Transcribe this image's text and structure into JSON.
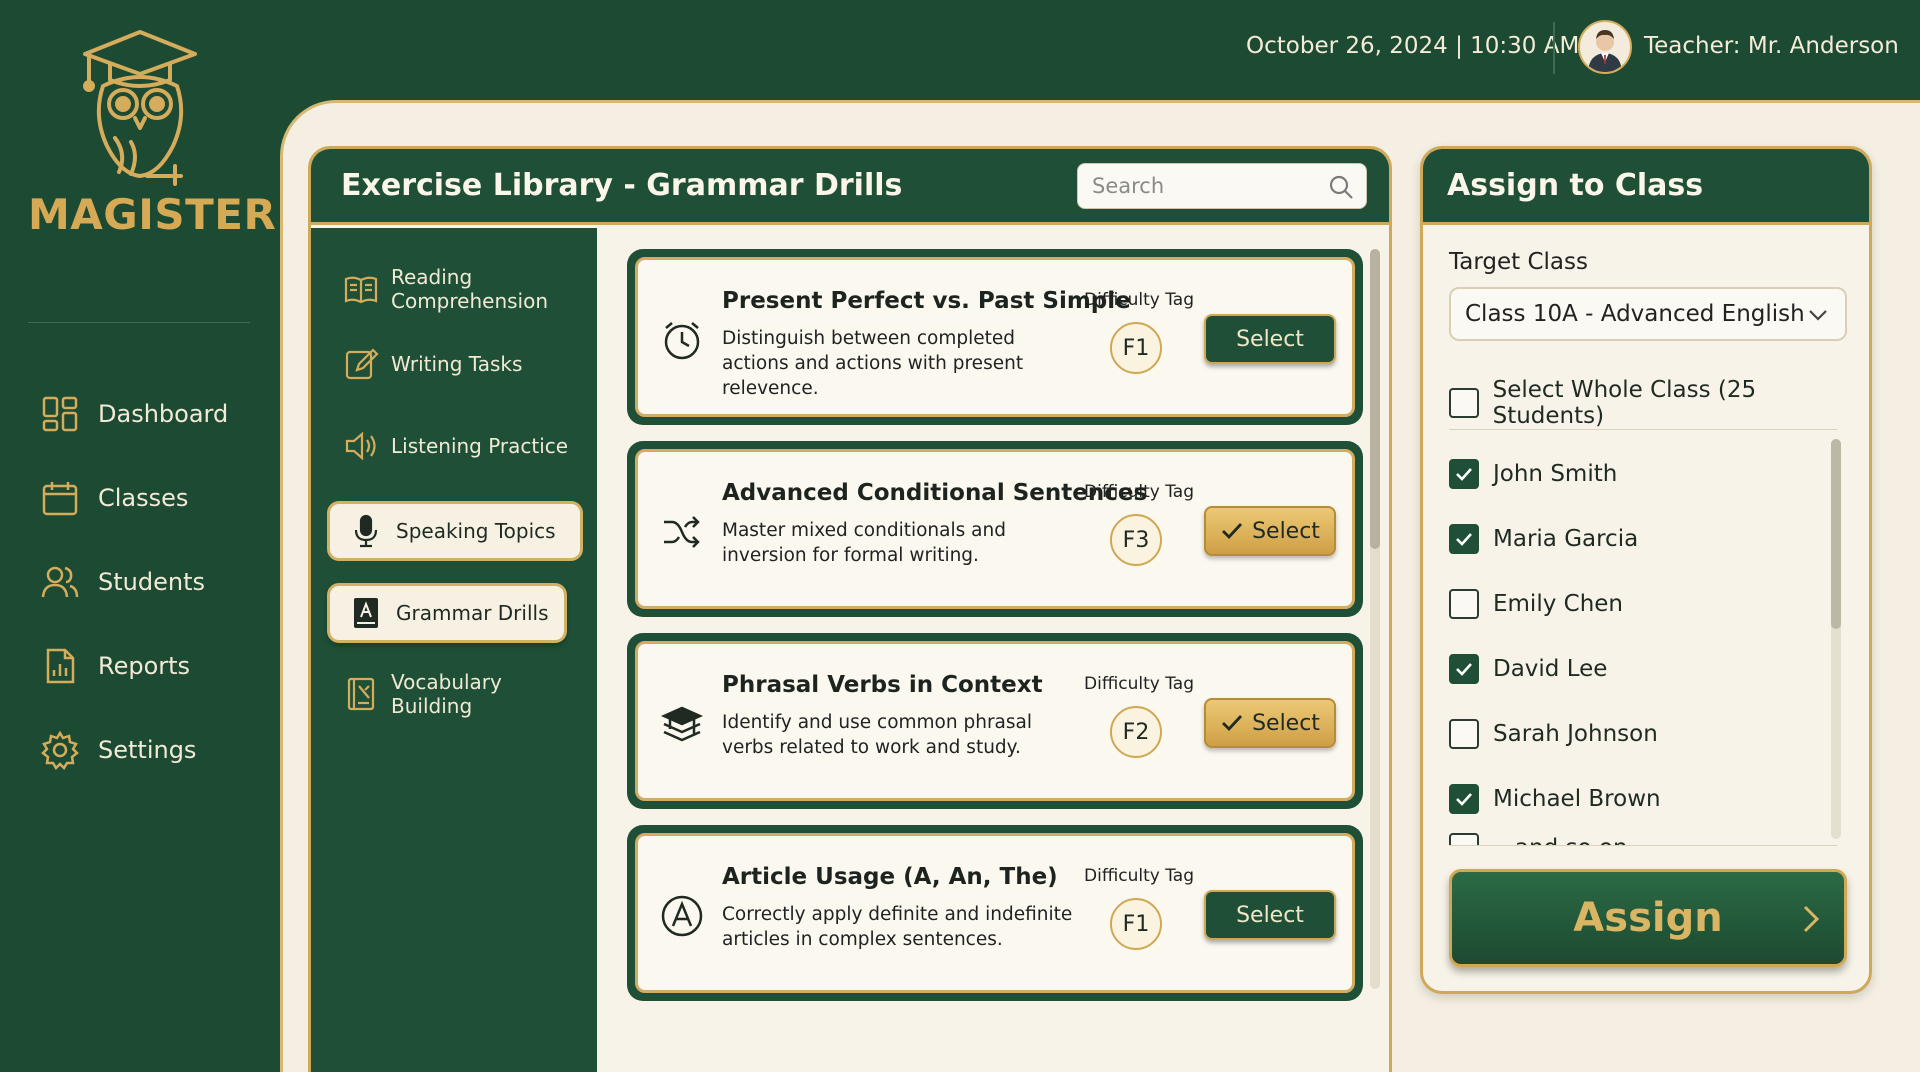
{
  "app": {
    "name": "MAGISTER"
  },
  "header": {
    "datetime": "October 26, 2024 | 10:30 AM",
    "teacher": "Teacher: Mr. Anderson"
  },
  "sidebar": {
    "items": [
      {
        "label": "Dashboard",
        "icon": "dashboard-icon"
      },
      {
        "label": "Classes",
        "icon": "calendar-icon"
      },
      {
        "label": "Students",
        "icon": "users-icon"
      },
      {
        "label": "Reports",
        "icon": "report-icon"
      },
      {
        "label": "Settings",
        "icon": "gear-icon"
      }
    ]
  },
  "library": {
    "title": "Exercise Library - Grammar Drills",
    "search_placeholder": "Search",
    "categories": [
      {
        "label": "Reading Comprehension",
        "icon": "book-icon"
      },
      {
        "label": "Writing Tasks",
        "icon": "pencil-icon"
      },
      {
        "label": "Listening Practice",
        "icon": "speaker-icon"
      },
      {
        "label": "Speaking Topics",
        "icon": "microphone-icon"
      },
      {
        "label": "Grammar Drills",
        "icon": "grammar-book-icon",
        "active": true
      },
      {
        "label": "Vocabulary Building",
        "icon": "vocabulary-icon"
      }
    ],
    "exercises": [
      {
        "title": "Present Perfect vs. Past Simple",
        "description": "Distinguish between completed actions and actions with present relevence.",
        "difficulty_label": "Difficulty Tag",
        "difficulty": "F1",
        "button": "Select",
        "selected": false,
        "icon": "clock-icon"
      },
      {
        "title": "Advanced Conditional Sentences",
        "description": "Master mixed conditionals and inversion for formal writing.",
        "difficulty_label": "Difficulty Tag",
        "difficulty": "F3",
        "button": "Select",
        "selected": true,
        "icon": "shuffle-icon"
      },
      {
        "title": "Phrasal Verbs in Context",
        "description": "Identify and use common phrasal verbs related to work and study.",
        "difficulty_label": "Difficulty Tag",
        "difficulty": "F2",
        "button": "Select",
        "selected": true,
        "icon": "books-icon"
      },
      {
        "title": "Article Usage (A, An, The)",
        "description": "Correctly apply definite and indefinite articles in complex sentences.",
        "difficulty_label": "Difficulty Tag",
        "difficulty": "F1",
        "button": "Select",
        "selected": false,
        "icon": "letter-a-icon"
      }
    ]
  },
  "assign": {
    "title": "Assign to Class",
    "target_label": "Target Class",
    "target_value": "Class 10A - Advanced English",
    "whole_class_label": "Select Whole Class (25 Students)",
    "whole_class_checked": false,
    "students": [
      {
        "name": "John Smith",
        "checked": true
      },
      {
        "name": "Maria Garcia",
        "checked": true
      },
      {
        "name": "Emily Chen",
        "checked": false
      },
      {
        "name": "David Lee",
        "checked": true
      },
      {
        "name": "Sarah Johnson",
        "checked": false
      },
      {
        "name": "Michael Brown",
        "checked": true
      },
      {
        "name": "...and so on",
        "checked": false
      }
    ],
    "button": "Assign"
  },
  "colors": {
    "primary_green": "#1f5037",
    "gold": "#d4ac5b",
    "background_cream": "#f4efe2"
  }
}
